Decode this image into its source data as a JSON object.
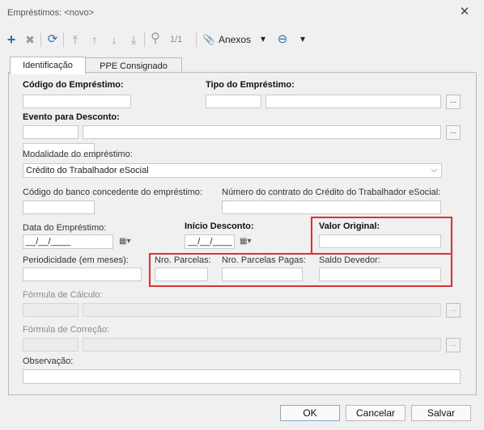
{
  "window": {
    "title": "Empréstimos: <novo>",
    "close_icon": "close-icon"
  },
  "toolbar": {
    "add_icon": "+",
    "delete_icon": "✖",
    "refresh_icon": "⟳",
    "first_icon": "⤒",
    "up_icon": "↑",
    "down_icon": "↓",
    "last_icon": "⤓",
    "search_icon": "⚲",
    "page_counter": "1/1",
    "attach_icon": "📎",
    "attachments_label": "Anexos",
    "attachments_dropdown": "▾",
    "status_icon": "⊖",
    "status_dropdown": "▾"
  },
  "tabs": [
    {
      "label": "Identificação"
    },
    {
      "label": "PPE Consignado"
    }
  ],
  "form": {
    "codigo_emprestimo": {
      "label": "Código do Empréstimo:",
      "value": ""
    },
    "tipo_emprestimo": {
      "label": "Tipo do Empréstimo:",
      "code": "",
      "desc": ""
    },
    "evento_desconto": {
      "label": "Evento para Desconto:",
      "code": "",
      "desc": ""
    },
    "extra_field": {
      "value": ""
    },
    "modalidade": {
      "label": "Modalidade do empréstimo:",
      "value": "Crédito do Trabalhador eSocial"
    },
    "codigo_banco": {
      "label": "Código do banco concedente do empréstimo:",
      "value": ""
    },
    "numero_contrato": {
      "label": "Número do contrato do Crédito do Trabalhador eSocial:",
      "value": ""
    },
    "data_emprestimo": {
      "label": "Data do Empréstimo:",
      "value": "__/__/____"
    },
    "inicio_desconto": {
      "label": "Início Desconto:",
      "value": "__/__/____"
    },
    "valor_original": {
      "label": "Valor Original:",
      "value": ""
    },
    "periodicidade": {
      "label": "Periodicidade (em meses):",
      "value": ""
    },
    "nro_parcelas": {
      "label": "Nro. Parcelas:",
      "value": ""
    },
    "nro_parcelas_pagas": {
      "label": "Nro. Parcelas Pagas:",
      "value": ""
    },
    "saldo_devedor": {
      "label": "Saldo Devedor:",
      "value": ""
    },
    "formula_calculo": {
      "label": "Fórmula de Cálculo:",
      "code": "",
      "desc": ""
    },
    "formula_correcao": {
      "label": "Fórmula de Correção:",
      "code": "",
      "desc": ""
    },
    "observacao": {
      "label": "Observação:",
      "value": ""
    },
    "lookup_label": "...",
    "chevron": "⌵",
    "calendar": "▦▾"
  },
  "buttons": {
    "ok": "OK",
    "cancel": "Cancelar",
    "save": "Salvar"
  },
  "colors": {
    "highlight": "#e03030",
    "accent": "#2a6fb0"
  }
}
